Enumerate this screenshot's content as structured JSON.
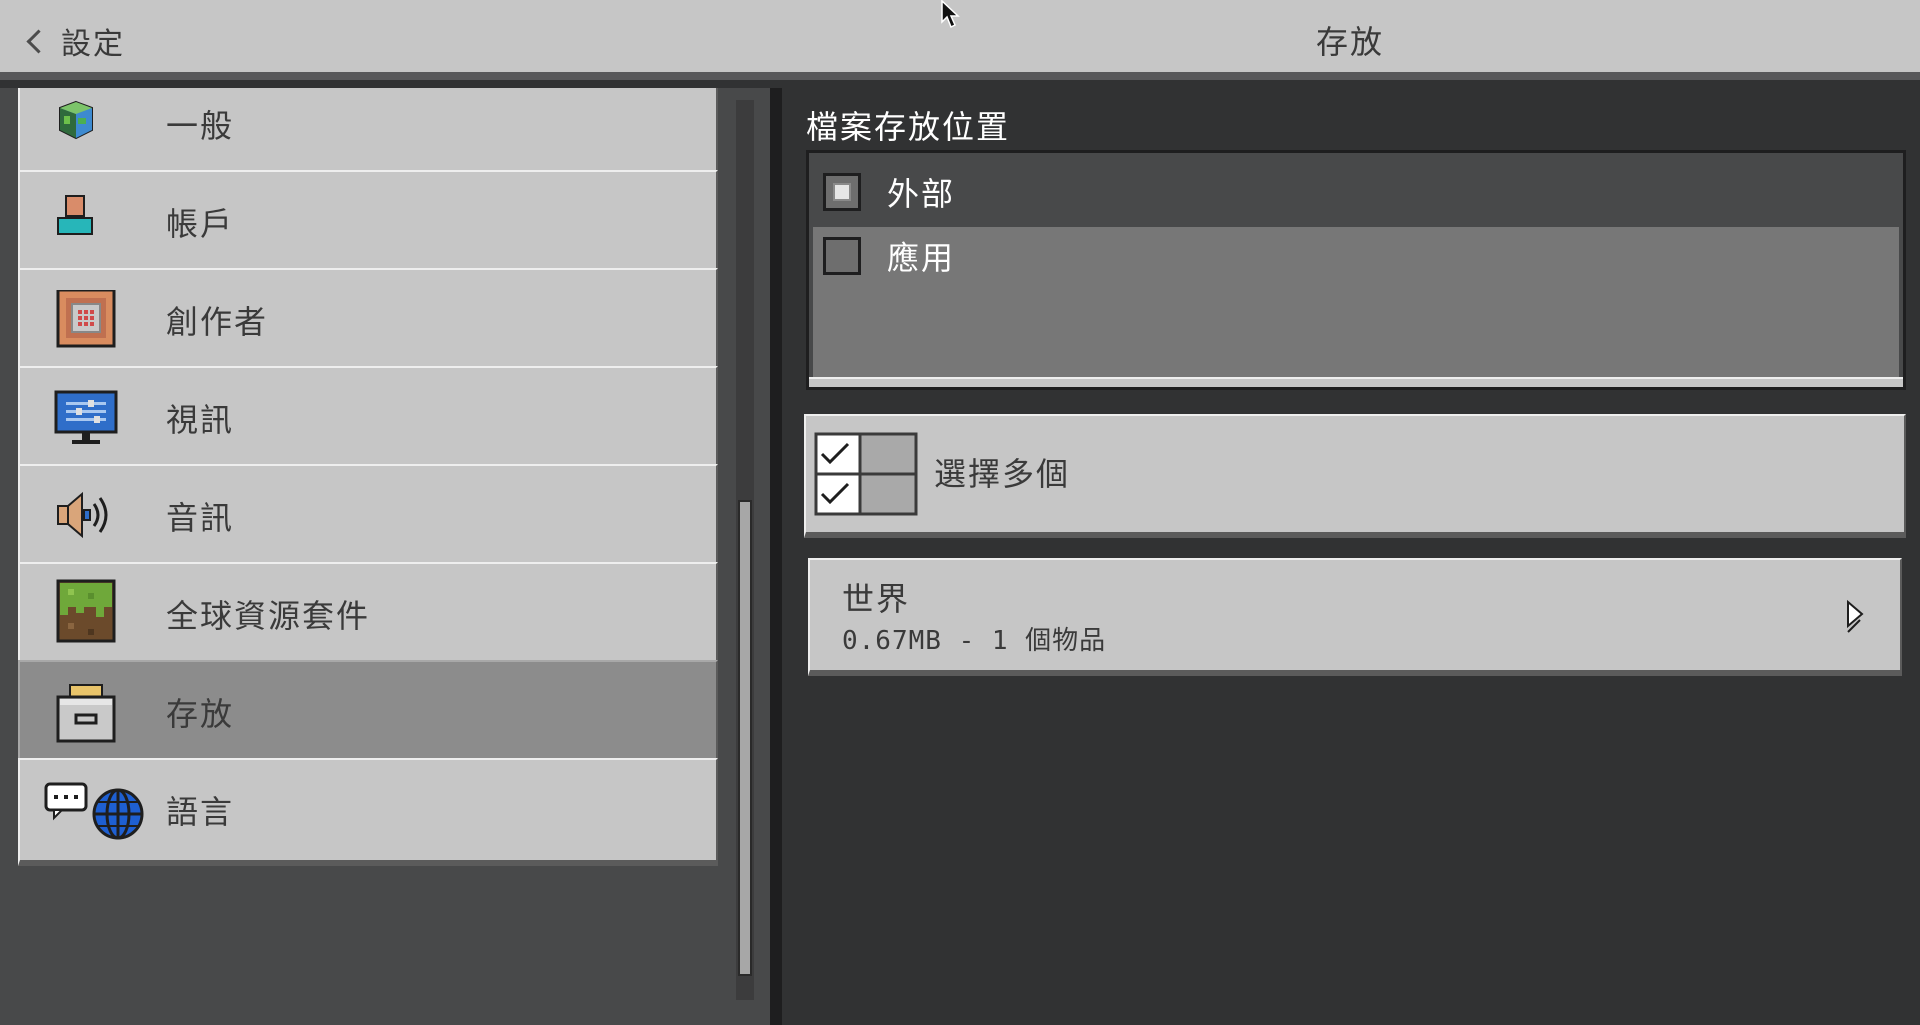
{
  "header": {
    "back_label": "設定",
    "title": "存放"
  },
  "sidebar": {
    "items": [
      {
        "label": "一般",
        "icon": "globe-icon"
      },
      {
        "label": "帳戶",
        "icon": "account-icon"
      },
      {
        "label": "創作者",
        "icon": "command-block-icon"
      },
      {
        "label": "視訊",
        "icon": "monitor-icon"
      },
      {
        "label": "音訊",
        "icon": "speaker-icon"
      },
      {
        "label": "全球資源套件",
        "icon": "grass-block-icon"
      },
      {
        "label": "存放",
        "icon": "storage-drawer-icon",
        "active": true
      },
      {
        "label": "語言",
        "icon": "language-icon"
      }
    ]
  },
  "main": {
    "section_title": "檔案存放位置",
    "locations": [
      {
        "label": "外部",
        "selected": true
      },
      {
        "label": "應用",
        "selected": false
      }
    ],
    "multi_select_label": "選擇多個",
    "world": {
      "name": "世界",
      "meta": "0.67MB - 1 個物品"
    }
  },
  "colors": {
    "panel": "#c6c6c6",
    "dark_bg": "#313233",
    "selected_item": "#8c8c8c"
  }
}
